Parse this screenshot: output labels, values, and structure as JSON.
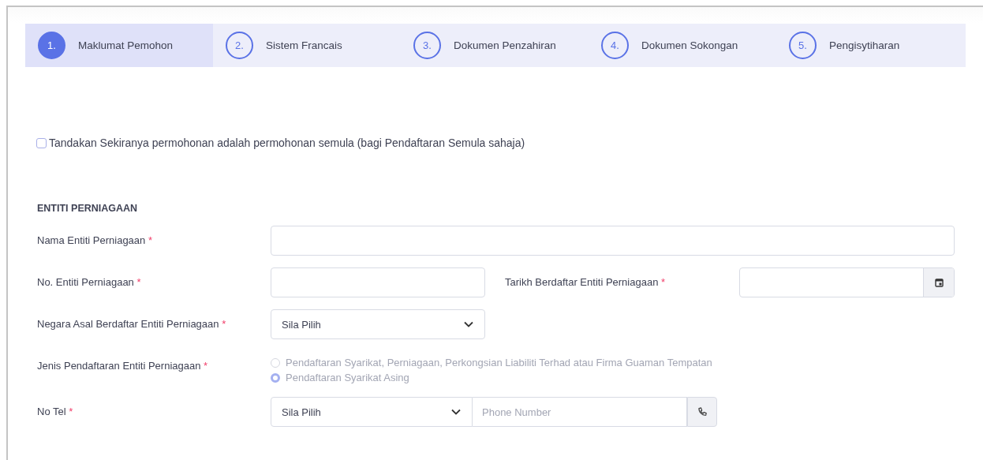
{
  "steps": [
    {
      "number": "1.",
      "label": "Maklumat Pemohon",
      "selected": true
    },
    {
      "number": "2.",
      "label": "Sistem Francais",
      "selected": false
    },
    {
      "number": "3.",
      "label": "Dokumen Penzahiran",
      "selected": false
    },
    {
      "number": "4.",
      "label": "Dokumen Sokongan",
      "selected": false
    },
    {
      "number": "5.",
      "label": "Pengisytiharan",
      "selected": false
    }
  ],
  "resubmission": {
    "label": "Tandakan Sekiranya permohonan adalah permohonan semula (bagi Pendaftaran Semula sahaja)",
    "checked": false
  },
  "section_title": "ENTITI PERNIAGAAN",
  "rows": [
    {
      "fields": [
        {
          "kind": "wide_text",
          "label": "Nama Entiti Perniagaan",
          "required_mark": "*"
        }
      ]
    },
    {
      "fields": [
        {
          "kind": "text",
          "label": "No. Entiti Perniagaan",
          "required_mark": "*"
        },
        {
          "kind": "date",
          "label": "Tarikh Berdaftar Entiti Perniagaan",
          "required_mark": "*"
        }
      ]
    },
    {
      "fields": [
        {
          "kind": "select",
          "label": "Negara Asal Berdaftar Entiti Perniagaan",
          "required_mark": "*",
          "value": "Sila Pilih"
        }
      ]
    },
    {
      "fields": [
        {
          "kind": "radio",
          "label": "Jenis Pendaftaran Entiti Perniagaan",
          "required_mark": "*",
          "disabled": true,
          "options": [
            {
              "label": "Pendaftaran Syarikat, Perniagaan, Perkongsian Liabiliti Terhad atau Firma Guaman Tempatan",
              "selected": false
            },
            {
              "label": "Pendaftaran Syarikat Asing",
              "selected": true
            }
          ]
        }
      ]
    },
    {
      "fields": [
        {
          "kind": "phone",
          "label": "No Tel",
          "required_mark": "*",
          "value": "Sila Pilih",
          "placeholder": "Phone Number"
        }
      ]
    }
  ]
}
